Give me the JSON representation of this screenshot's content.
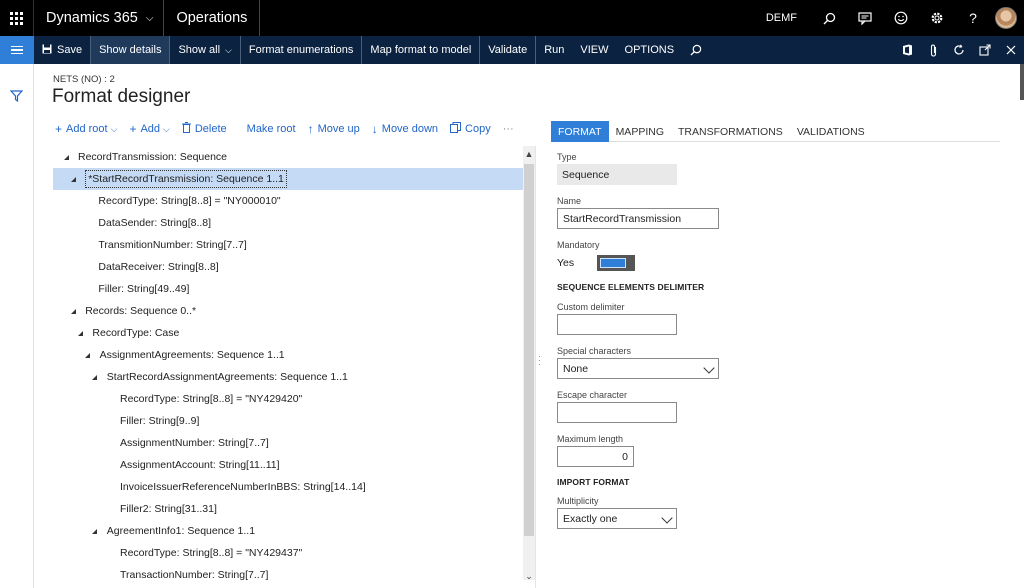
{
  "app": {
    "brand": "Dynamics 365",
    "module": "Operations",
    "company": "DEMF"
  },
  "actionbar": {
    "save": "Save",
    "show_details": "Show details",
    "show_all": "Show all",
    "format_enumerations": "Format enumerations",
    "map_format_to_model": "Map format to model",
    "validate": "Validate",
    "run": "Run",
    "view": "VIEW",
    "options": "OPTIONS"
  },
  "page": {
    "breadcrumb": "NETS (NO) : 2",
    "title": "Format designer"
  },
  "tree_toolbar": {
    "add_root": "Add root",
    "add": "Add",
    "delete": "Delete",
    "make_root": "Make root",
    "move_up": "Move up",
    "move_down": "Move down",
    "copy": "Copy",
    "more": "···"
  },
  "tree": [
    {
      "label": "RecordTransmission: Sequence",
      "level": 0,
      "expanded": true,
      "selected": false
    },
    {
      "label": "*StartRecordTransmission: Sequence 1..1",
      "level": 1,
      "expanded": true,
      "selected": true
    },
    {
      "label": "RecordType: String[8..8] = \"NY000010\"",
      "level": 2,
      "expanded": false,
      "selected": false
    },
    {
      "label": "DataSender: String[8..8]",
      "level": 2,
      "expanded": false,
      "selected": false
    },
    {
      "label": "TransmitionNumber: String[7..7]",
      "level": 2,
      "expanded": false,
      "selected": false
    },
    {
      "label": "DataReceiver: String[8..8]",
      "level": 2,
      "expanded": false,
      "selected": false
    },
    {
      "label": "Filler: String[49..49]",
      "level": 2,
      "expanded": false,
      "selected": false
    },
    {
      "label": "Records: Sequence 0..*",
      "level": 1,
      "expanded": true,
      "selected": false
    },
    {
      "label": "RecordType: Case",
      "level": 2,
      "expanded": true,
      "selected": false
    },
    {
      "label": "AssignmentAgreements: Sequence 1..1",
      "level": 3,
      "expanded": true,
      "selected": false
    },
    {
      "label": "StartRecordAssignmentAgreements: Sequence 1..1",
      "level": 4,
      "expanded": true,
      "selected": false
    },
    {
      "label": "RecordType: String[8..8] = \"NY429420\"",
      "level": 5,
      "expanded": false,
      "selected": false
    },
    {
      "label": "Filler: String[9..9]",
      "level": 5,
      "expanded": false,
      "selected": false
    },
    {
      "label": "AssignmentNumber: String[7..7]",
      "level": 5,
      "expanded": false,
      "selected": false
    },
    {
      "label": "AssignmentAccount: String[11..11]",
      "level": 5,
      "expanded": false,
      "selected": false
    },
    {
      "label": "InvoiceIssuerReferenceNumberInBBS: String[14..14]",
      "level": 5,
      "expanded": false,
      "selected": false
    },
    {
      "label": "Filler2: String[31..31]",
      "level": 5,
      "expanded": false,
      "selected": false
    },
    {
      "label": "AgreementInfo1: Sequence 1..1",
      "level": 4,
      "expanded": true,
      "selected": false
    },
    {
      "label": "RecordType: String[8..8] = \"NY429437\"",
      "level": 5,
      "expanded": false,
      "selected": false
    },
    {
      "label": "TransactionNumber: String[7..7]",
      "level": 5,
      "expanded": false,
      "selected": false
    }
  ],
  "tabs": [
    "FORMAT",
    "MAPPING",
    "TRANSFORMATIONS",
    "VALIDATIONS"
  ],
  "format": {
    "type_label": "Type",
    "type_value": "Sequence",
    "name_label": "Name",
    "name_value": "StartRecordTransmission",
    "mandatory_label": "Mandatory",
    "mandatory_value": "Yes",
    "seq_delim_header": "SEQUENCE ELEMENTS DELIMITER",
    "custom_delim_label": "Custom delimiter",
    "custom_delim_value": "",
    "special_chars_label": "Special characters",
    "special_chars_value": "None",
    "escape_char_label": "Escape character",
    "escape_char_value": "",
    "max_length_label": "Maximum length",
    "max_length_value": "0",
    "import_format_header": "IMPORT FORMAT",
    "multiplicity_label": "Multiplicity",
    "multiplicity_value": "Exactly one"
  }
}
